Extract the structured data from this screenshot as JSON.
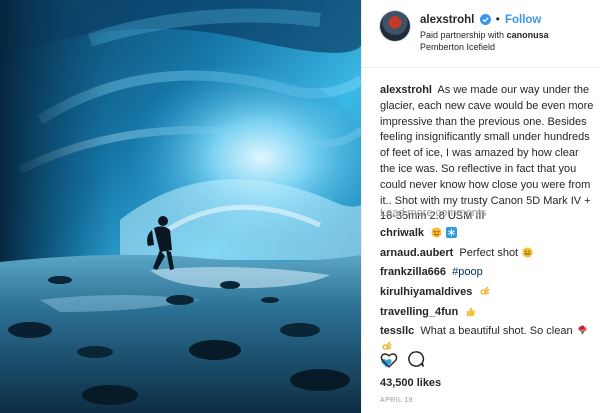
{
  "post": {
    "author": {
      "username": "alexstrohl",
      "follow_label": "Follow",
      "separator": "•",
      "partnership_prefix": "Paid partnership with",
      "partner": "canonusa",
      "location": "Pemberton Icefield"
    },
    "caption": {
      "username": "alexstrohl",
      "text": "As we made our way under the glacier, each new cave would be even more impressive than the previous one. Besides feeling insignificantly small under hundreds of feet of ice, I was amazed by how clear the ice was. So reflective in fact that you could never know how close you were from it.. Shot with my trusty Canon 5D Mark IV + 16-35mm 2.8 USM III"
    },
    "load_more_label": "Load more comments",
    "comments": [
      {
        "username": "chriwalk",
        "text": "",
        "emoji": [
          "smiling-heart-eyes-icon",
          "snowflake-icon"
        ]
      },
      {
        "username": "arnaud.aubert",
        "text": "Perfect shot",
        "emoji": [
          "grinning-icon"
        ]
      },
      {
        "username": "frankzilla666",
        "text": "#poop",
        "emoji": []
      },
      {
        "username": "kirulhiyamaldives",
        "text": "",
        "emoji": [
          "ok-hand-icon"
        ]
      },
      {
        "username": "travelling_4fun",
        "text": "",
        "emoji": [
          "thumbs-up-icon"
        ]
      },
      {
        "username": "tessllc",
        "text": "What a beautiful shot. So clean",
        "emoji": [
          "bouquet-icon",
          "ok-hand-icon",
          "blue-heart-icon"
        ]
      }
    ],
    "likes": "43,500 likes",
    "date": "APRIL 18"
  },
  "colors": {
    "link_blue": "#3897f0",
    "hashtag": "#003569",
    "muted": "#999999",
    "ice_blue": "#1fa3d9"
  }
}
